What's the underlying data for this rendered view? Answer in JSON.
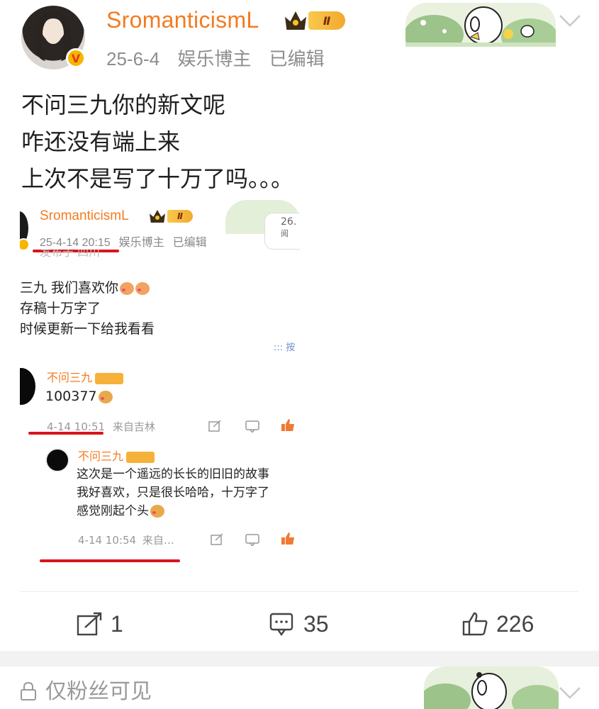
{
  "post": {
    "username": "SromanticismL",
    "level_badge": "Ⅱ",
    "avatar_badge": "V",
    "date": "25-6-4",
    "role": "娱乐博主",
    "edited": "已编辑",
    "text_lines": [
      "不问三九你的新文呢",
      "咋还没有端上来",
      "上次不是写了十万了吗。。。"
    ]
  },
  "embedded": {
    "username": "SromanticismL",
    "level_badge": "Ⅱ",
    "datetime": "25-4-14 20:15",
    "role": "娱乐博主",
    "edited": "已编辑",
    "cut_line": "发布于 四川",
    "views_partial": "26.",
    "views_unit": "阅",
    "body_lines": [
      "三九 我们喜欢你",
      "存稿十万字了",
      "时候更新一下给我看看"
    ],
    "more_link": "::: 按",
    "comment1": {
      "name": "不问三九",
      "text": "100377",
      "time": "4-14 10:51",
      "source": "来自吉林"
    },
    "comment2": {
      "name": "不问三九",
      "lines": [
        "这次是一个遥远的长长的旧旧的故事",
        "我好喜欢，只是很长哈哈，十万字了",
        "感觉刚起个头"
      ],
      "time": "4-14 10:54",
      "source": "来自…"
    }
  },
  "actions": {
    "repost_count": "1",
    "comment_count": "35",
    "like_count": "226"
  },
  "next_post": {
    "visibility": "仅粉丝可见"
  },
  "colors": {
    "username": "#f47b20",
    "underline": "#d8141c",
    "badge_gold": "#f7b500"
  }
}
